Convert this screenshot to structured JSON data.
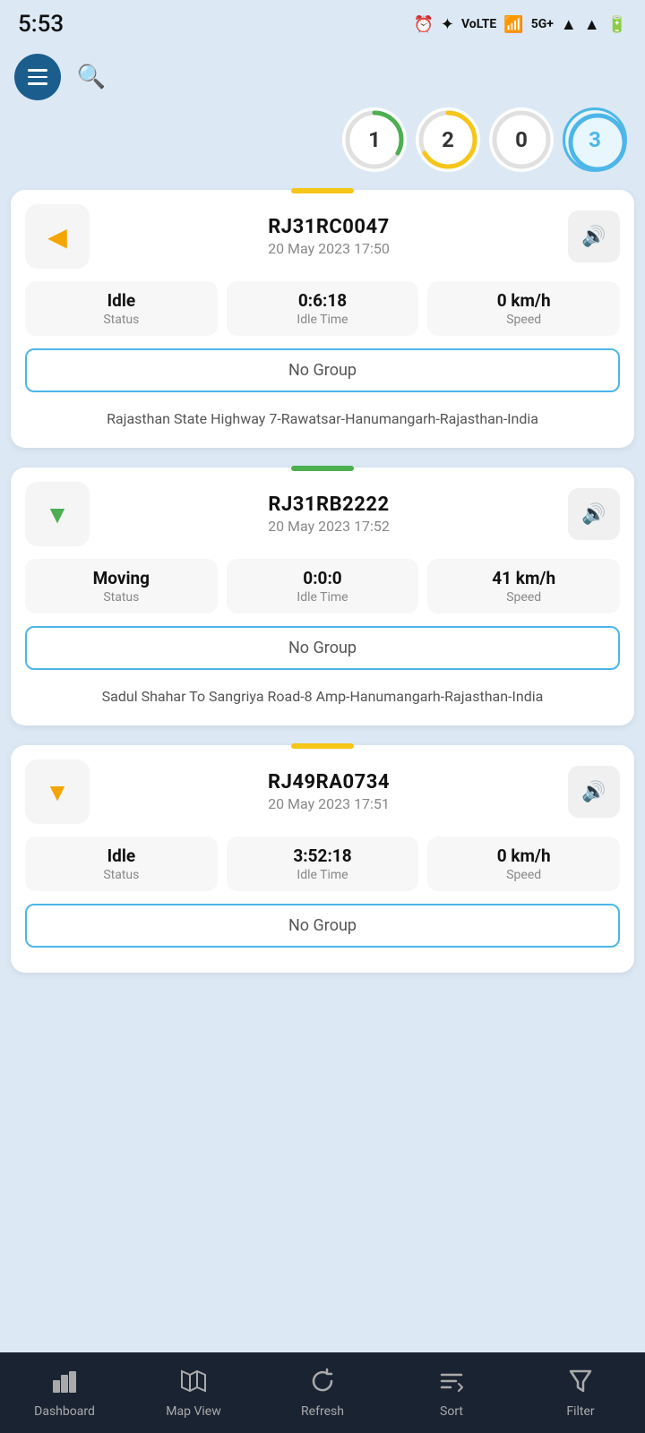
{
  "statusBar": {
    "time": "5:53",
    "icons": "⏰ ✦ LTE 5G+ ▲ ▲ 🔋"
  },
  "topBar": {
    "searchPlaceholder": "Search"
  },
  "counters": [
    {
      "id": "c1",
      "value": "1",
      "color": "#4caf50",
      "percent": 33
    },
    {
      "id": "c2",
      "value": "2",
      "color": "#f5c518",
      "percent": 66
    },
    {
      "id": "c3",
      "value": "0",
      "color": "#cccccc",
      "percent": 0
    },
    {
      "id": "c4",
      "value": "3",
      "color": "#4db6e8",
      "percent": 100,
      "active": true
    }
  ],
  "cards": [
    {
      "id": "card1",
      "statusColor": "#f5c518",
      "directionColor": "#f5a500",
      "vehicleId": "RJ31RC0047",
      "date": "20 May 2023 17:50",
      "status": "Idle",
      "idleTime": "0:6:18",
      "speed": "0 km/h",
      "group": "No Group",
      "location": "Rajasthan State Highway 7-Rawatsar-Hanumangarh-Rajasthan-India"
    },
    {
      "id": "card2",
      "statusColor": "#4caf50",
      "directionColor": "#4caf50",
      "vehicleId": "RJ31RB2222",
      "date": "20 May 2023 17:52",
      "status": "Moving",
      "idleTime": "0:0:0",
      "speed": "41 km/h",
      "group": "No Group",
      "location": "Sadul Shahar To Sangriya Road-8 Amp-Hanumangarh-Rajasthan-India"
    },
    {
      "id": "card3",
      "statusColor": "#f5c518",
      "directionColor": "#f5a500",
      "vehicleId": "RJ49RA0734",
      "date": "20 May 2023 17:51",
      "status": "Idle",
      "idleTime": "3:52:18",
      "speed": "0 km/h",
      "group": "No Group",
      "location": ""
    }
  ],
  "bottomNav": [
    {
      "id": "nav-dashboard",
      "label": "Dashboard",
      "icon": "📊",
      "active": false
    },
    {
      "id": "nav-mapview",
      "label": "Map View",
      "icon": "🗺",
      "active": false
    },
    {
      "id": "nav-refresh",
      "label": "Refresh",
      "icon": "🔄",
      "active": false
    },
    {
      "id": "nav-sort",
      "label": "Sort",
      "icon": "≣",
      "active": false
    },
    {
      "id": "nav-filter",
      "label": "Filter",
      "icon": "⛛",
      "active": false
    }
  ]
}
